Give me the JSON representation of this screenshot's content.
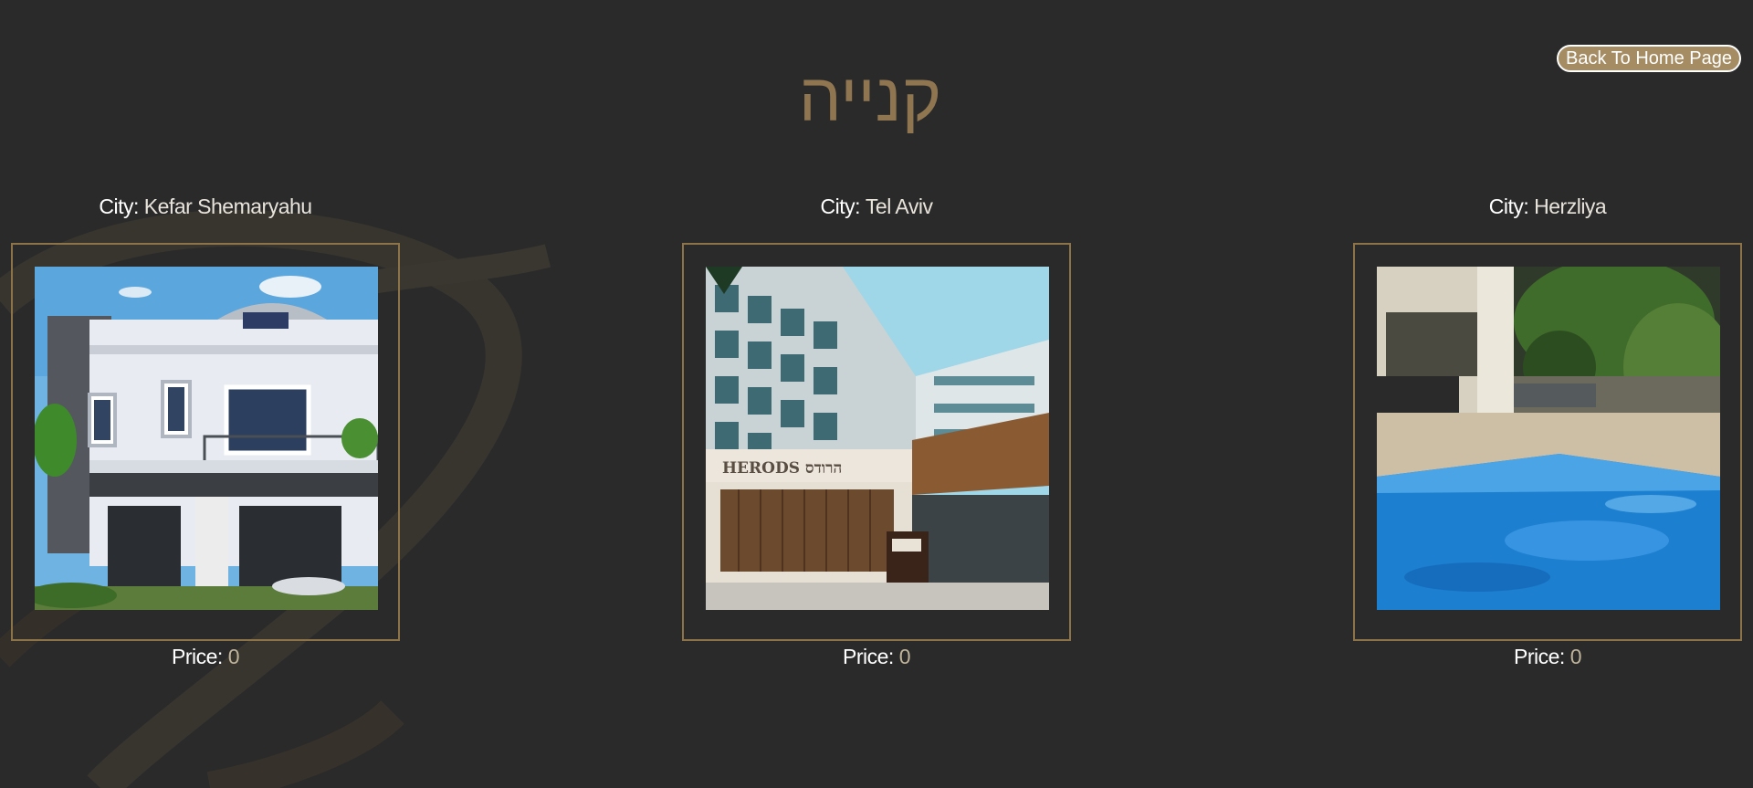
{
  "header": {
    "title": "קנייה",
    "back_button": "Back To Home Page"
  },
  "listings": [
    {
      "city_label": "City:",
      "city": "Kefar Shemaryahu",
      "price_label": "Price:",
      "price": "0",
      "photo": "white-villa-photo"
    },
    {
      "city_label": "City:",
      "city": "Tel Aviv",
      "price_label": "Price:",
      "price": "0",
      "photo": "herods-building-photo",
      "photo_sign_text": "HERODS הרודס"
    },
    {
      "city_label": "City:",
      "city": "Herzliya",
      "price_label": "Price:",
      "price": "0",
      "photo": "pool-patio-photo"
    }
  ],
  "colors": {
    "background": "#2a2a2a",
    "accent_gold": "#8c7448",
    "title_gold": "#8f7651",
    "button_fill": "#a58c63"
  }
}
